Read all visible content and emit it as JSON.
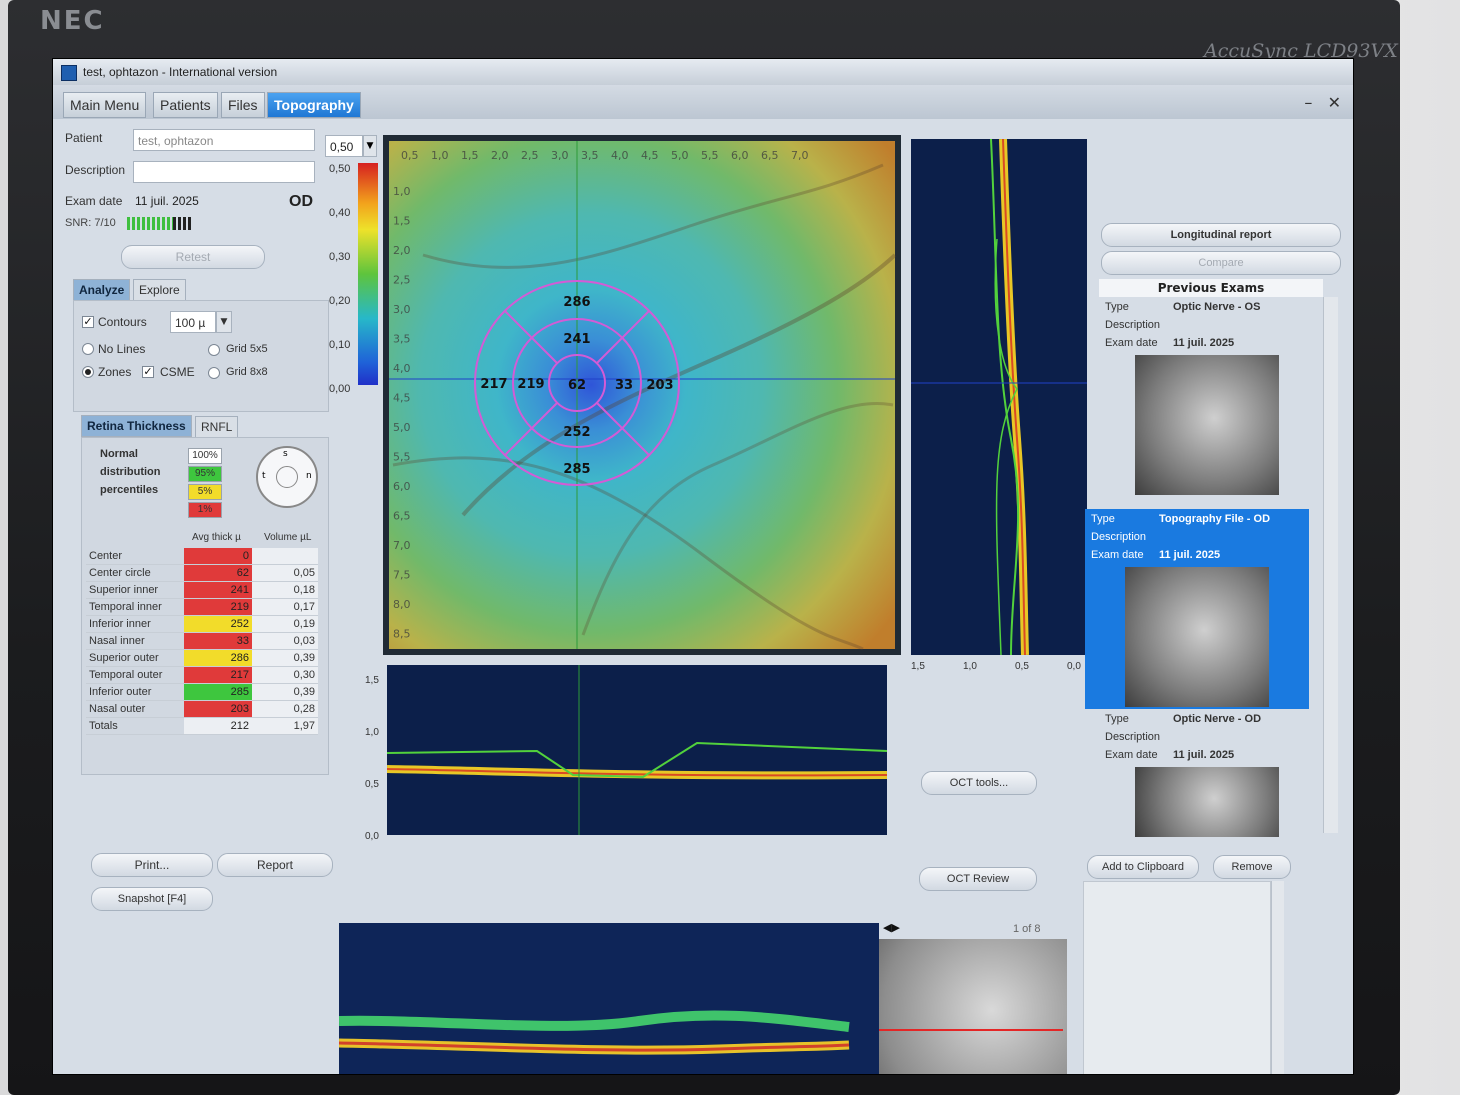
{
  "monitor": {
    "brand": "NEC",
    "model": "AccuSync LCD93VX"
  },
  "window": {
    "title": "test, ophtazon - International version"
  },
  "tabs": [
    {
      "label": "Main Menu",
      "active": false
    },
    {
      "label": "Patients",
      "active": false
    },
    {
      "label": "Files",
      "active": false
    },
    {
      "label": "Topography",
      "active": true
    }
  ],
  "window_controls": {
    "minimize": "–",
    "close": "✕"
  },
  "patient": {
    "patient_label": "Patient",
    "patient_value": "test, ophtazon",
    "description_label": "Description",
    "description_value": "",
    "exam_date_label": "Exam date",
    "exam_date_value": "11 juil. 2025",
    "eye": "OD",
    "snr": "SNR: 7/10",
    "retest": "Retest"
  },
  "scale": {
    "selected": "0,50",
    "ticks": [
      "0,50",
      "0,40",
      "0,30",
      "0,20",
      "0,10",
      "0,00"
    ]
  },
  "analyze": {
    "tabs": [
      "Analyze",
      "Explore"
    ],
    "contours_label": "Contours",
    "contours_value": "100 µ",
    "no_lines": "No Lines",
    "zones": "Zones",
    "csme": "CSME",
    "grid5": "Grid 5x5",
    "grid8": "Grid 8x8"
  },
  "thickness": {
    "tabs": [
      "Retina Thickness",
      "RNFL"
    ],
    "legend_title": [
      "Normal",
      "distribution",
      "percentiles"
    ],
    "legend": [
      {
        "label": "100%",
        "color": "#ffffff"
      },
      {
        "label": "95%",
        "color": "#3ec63e"
      },
      {
        "label": "5%",
        "color": "#f2dc2a"
      },
      {
        "label": "1%",
        "color": "#e03a3a"
      }
    ],
    "compass": {
      "s": "s",
      "t": "t",
      "n": "n"
    },
    "header": {
      "avg": "Avg thick µ",
      "vol": "Volume µL"
    },
    "rows": [
      {
        "name": "Center",
        "avg": "0",
        "vol": "",
        "color": "#e03a3a"
      },
      {
        "name": "Center circle",
        "avg": "62",
        "vol": "0,05",
        "color": "#e03a3a"
      },
      {
        "name": "Superior inner",
        "avg": "241",
        "vol": "0,18",
        "color": "#e03a3a"
      },
      {
        "name": "Temporal inner",
        "avg": "219",
        "vol": "0,17",
        "color": "#e03a3a"
      },
      {
        "name": "Inferior inner",
        "avg": "252",
        "vol": "0,19",
        "color": "#f2dc2a"
      },
      {
        "name": "Nasal inner",
        "avg": "33",
        "vol": "0,03",
        "color": "#e03a3a"
      },
      {
        "name": "Superior outer",
        "avg": "286",
        "vol": "0,39",
        "color": "#f2dc2a"
      },
      {
        "name": "Temporal outer",
        "avg": "217",
        "vol": "0,30",
        "color": "#e03a3a"
      },
      {
        "name": "Inferior outer",
        "avg": "285",
        "vol": "0,39",
        "color": "#3ec63e"
      },
      {
        "name": "Nasal outer",
        "avg": "203",
        "vol": "0,28",
        "color": "#e03a3a"
      },
      {
        "name": "Totals",
        "avg": "212",
        "vol": "1,97",
        "color": ""
      }
    ]
  },
  "actions": {
    "print": "Print...",
    "report": "Report",
    "snapshot": "Snapshot [F4]"
  },
  "map": {
    "top_ticks": [
      "0,5",
      "1,0",
      "1,5",
      "2,0",
      "2,5",
      "3,0",
      "3,5",
      "4,0",
      "4,5",
      "5,0",
      "5,5",
      "6,0",
      "6,5",
      "7,0"
    ],
    "left_ticks": [
      "1,0",
      "1,5",
      "2,0",
      "2,5",
      "3,0",
      "3,5",
      "4,0",
      "4,5",
      "5,0",
      "5,5",
      "6,0",
      "6,5",
      "7,0",
      "7,5",
      "8,0",
      "8,5"
    ],
    "zones": {
      "sup_outer": "286",
      "sup_inner": "241",
      "temp_outer": "217",
      "temp_inner": "219",
      "center": "62",
      "nasal_inner": "33",
      "nasal_outer": "203",
      "inf_inner": "252",
      "inf_outer": "285"
    }
  },
  "vertical_bscan": {
    "ticks": [
      "1,5",
      "1,0",
      "0,5",
      "0,0"
    ]
  },
  "horizontal_bscan": {
    "ticks": [
      "1,5",
      "1,0",
      "0,5",
      "0,0"
    ]
  },
  "oct": {
    "tools": "OCT tools...",
    "review": "OCT Review",
    "pager": "1 of 8"
  },
  "right": {
    "longitudinal": "Longitudinal report",
    "compare": "Compare",
    "previous_title": "Previous Exams",
    "type_label": "Type",
    "description_label": "Description",
    "exam_date_label": "Exam date",
    "exams": [
      {
        "type": "Optic Nerve - OS",
        "date": "11 juil. 2025",
        "selected": false
      },
      {
        "type": "Topography File - OD",
        "date": "11 juil. 2025",
        "selected": true
      },
      {
        "type": "Optic Nerve - OD",
        "date": "11 juil. 2025",
        "selected": false
      }
    ],
    "add_clipboard": "Add to Clipboard",
    "remove": "Remove"
  },
  "colors": {
    "accent": "#1f77d4",
    "selected_card": "#1a7ae0",
    "zone_ring": "#d35bd6"
  }
}
